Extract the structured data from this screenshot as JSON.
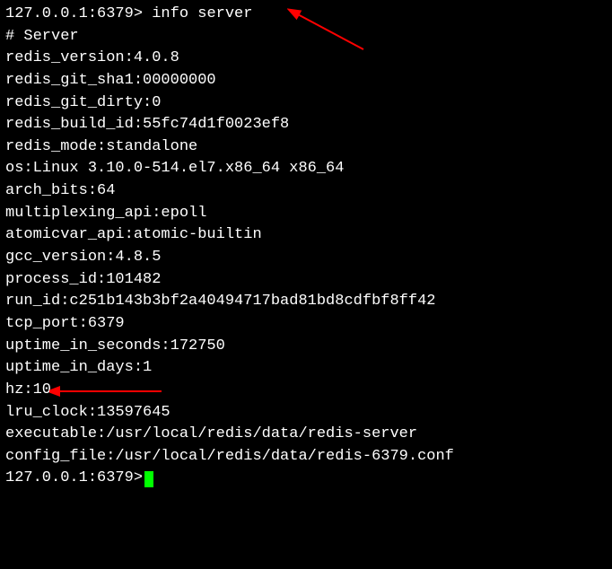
{
  "prompt1": "127.0.0.1:6379> ",
  "command": "info server",
  "section_header": "# Server",
  "lines": [
    "redis_version:4.0.8",
    "redis_git_sha1:00000000",
    "redis_git_dirty:0",
    "redis_build_id:55fc74d1f0023ef8",
    "redis_mode:standalone",
    "os:Linux 3.10.0-514.el7.x86_64 x86_64",
    "arch_bits:64",
    "multiplexing_api:epoll",
    "atomicvar_api:atomic-builtin",
    "gcc_version:4.8.5",
    "process_id:101482",
    "run_id:c251b143b3bf2a40494717bad81bd8cdfbf8ff42",
    "tcp_port:6379",
    "uptime_in_seconds:172750",
    "uptime_in_days:1",
    "hz:10",
    "lru_clock:13597645",
    "executable:/usr/local/redis/data/redis-server",
    "config_file:/usr/local/redis/data/redis-6379.conf"
  ],
  "prompt2": "127.0.0.1:6379> "
}
